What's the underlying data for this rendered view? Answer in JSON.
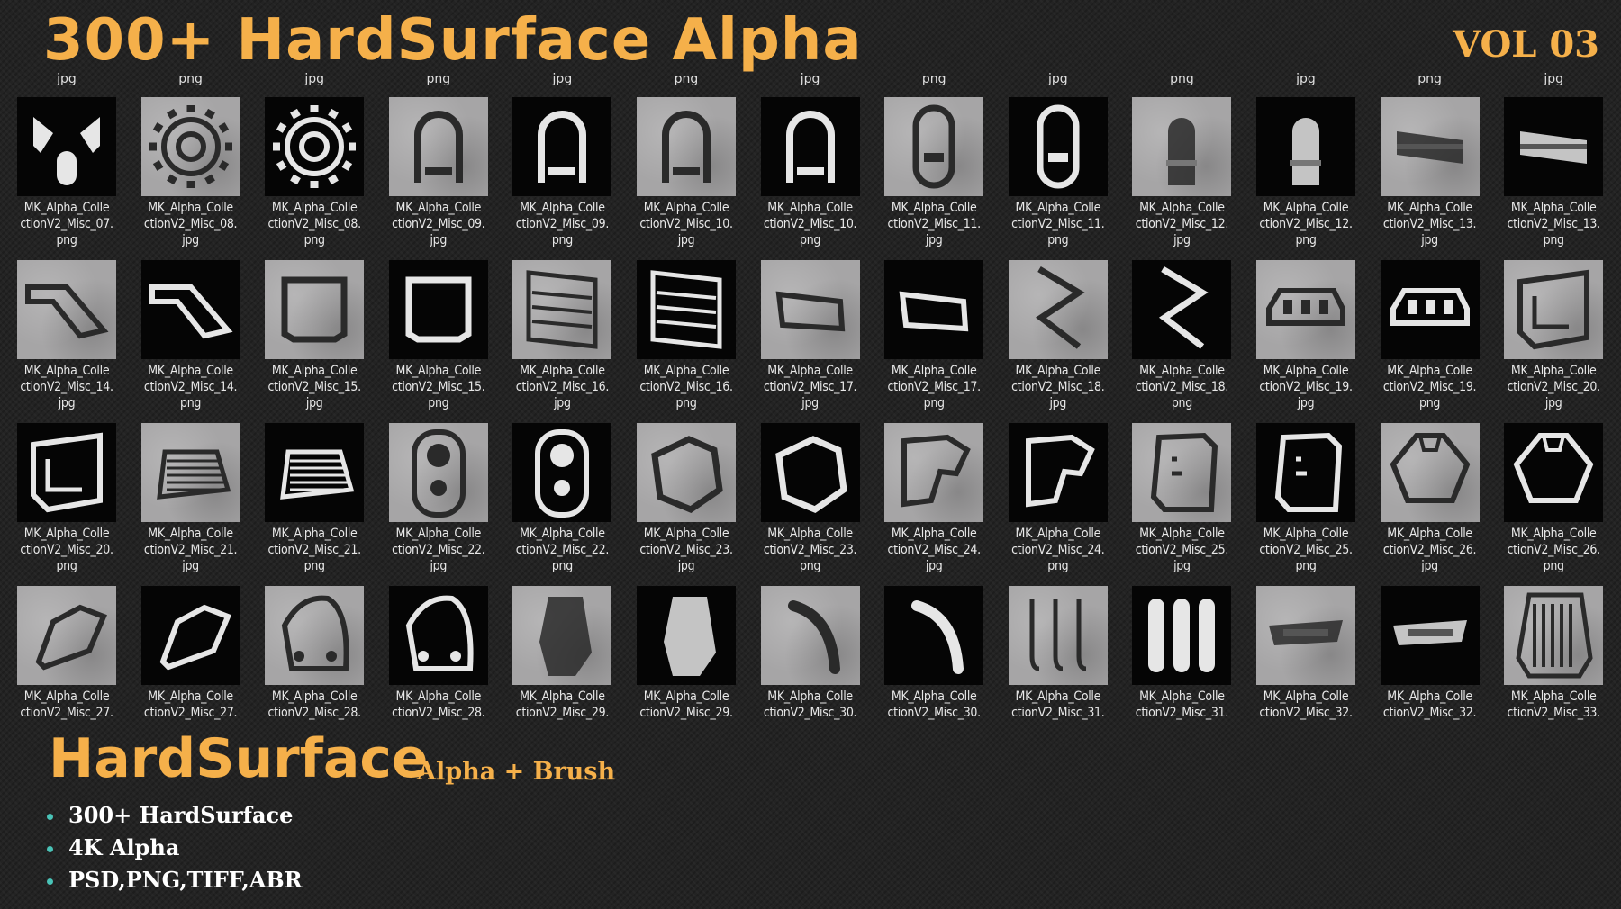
{
  "header": {
    "title": "300+ HardSurface Alpha",
    "volume": "VOL 03"
  },
  "top_exts": [
    "jpg",
    "png",
    "jpg",
    "png",
    "jpg",
    "png",
    "jpg",
    "png",
    "jpg",
    "png",
    "jpg",
    "png",
    "jpg"
  ],
  "rows": [
    [
      {
        "label": "MK_Alpha_CollectionV2_Misc_07.",
        "ext": "png",
        "bg": "black",
        "icon": "split-shape-icon"
      },
      {
        "label": "MK_Alpha_CollectionV2_Misc_08.",
        "ext": "jpg",
        "bg": "grey",
        "icon": "gear-icon"
      },
      {
        "label": "MK_Alpha_CollectionV2_Misc_08.",
        "ext": "png",
        "bg": "black",
        "icon": "gear-icon"
      },
      {
        "label": "MK_Alpha_CollectionV2_Misc_09.",
        "ext": "jpg",
        "bg": "grey",
        "icon": "arch-handle-icon"
      },
      {
        "label": "MK_Alpha_CollectionV2_Misc_09.",
        "ext": "png",
        "bg": "black",
        "icon": "arch-handle-icon"
      },
      {
        "label": "MK_Alpha_CollectionV2_Misc_10.",
        "ext": "jpg",
        "bg": "grey",
        "icon": "arch-handle-icon"
      },
      {
        "label": "MK_Alpha_CollectionV2_Misc_10.",
        "ext": "png",
        "bg": "black",
        "icon": "arch-handle-icon"
      },
      {
        "label": "MK_Alpha_CollectionV2_Misc_11.",
        "ext": "jpg",
        "bg": "grey",
        "icon": "capsule-icon"
      },
      {
        "label": "MK_Alpha_CollectionV2_Misc_11.",
        "ext": "png",
        "bg": "black",
        "icon": "capsule-icon"
      },
      {
        "label": "MK_Alpha_CollectionV2_Misc_12.",
        "ext": "jpg",
        "bg": "grey",
        "icon": "bullet-icon"
      },
      {
        "label": "MK_Alpha_CollectionV2_Misc_12.",
        "ext": "png",
        "bg": "black",
        "icon": "bullet-icon"
      },
      {
        "label": "MK_Alpha_CollectionV2_Misc_13.",
        "ext": "jpg",
        "bg": "grey",
        "icon": "bar-plate-icon"
      },
      {
        "label": "MK_Alpha_CollectionV2_Misc_13.",
        "ext": "png",
        "bg": "black",
        "icon": "bar-plate-icon"
      }
    ],
    [
      {
        "label": "MK_Alpha_CollectionV2_Misc_14.",
        "ext": "jpg",
        "bg": "grey",
        "icon": "slant-panel-icon"
      },
      {
        "label": "MK_Alpha_CollectionV2_Misc_14.",
        "ext": "png",
        "bg": "black",
        "icon": "slant-panel-icon"
      },
      {
        "label": "MK_Alpha_CollectionV2_Misc_15.",
        "ext": "jpg",
        "bg": "grey",
        "icon": "square-panel-icon"
      },
      {
        "label": "MK_Alpha_CollectionV2_Misc_15.",
        "ext": "png",
        "bg": "black",
        "icon": "square-panel-icon"
      },
      {
        "label": "MK_Alpha_CollectionV2_Misc_16.",
        "ext": "jpg",
        "bg": "grey",
        "icon": "vent-panel-icon"
      },
      {
        "label": "MK_Alpha_CollectionV2_Misc_16.",
        "ext": "png",
        "bg": "black",
        "icon": "vent-panel-icon"
      },
      {
        "label": "MK_Alpha_CollectionV2_Misc_17.",
        "ext": "jpg",
        "bg": "grey",
        "icon": "flat-panel-icon"
      },
      {
        "label": "MK_Alpha_CollectionV2_Misc_17.",
        "ext": "png",
        "bg": "black",
        "icon": "flat-panel-icon"
      },
      {
        "label": "MK_Alpha_CollectionV2_Misc_18.",
        "ext": "jpg",
        "bg": "grey",
        "icon": "zigzag-icon"
      },
      {
        "label": "MK_Alpha_CollectionV2_Misc_18.",
        "ext": "png",
        "bg": "black",
        "icon": "zigzag-icon"
      },
      {
        "label": "MK_Alpha_CollectionV2_Misc_19.",
        "ext": "jpg",
        "bg": "grey",
        "icon": "mechanical-part-icon"
      },
      {
        "label": "MK_Alpha_CollectionV2_Misc_19.",
        "ext": "png",
        "bg": "black",
        "icon": "mechanical-part-icon"
      },
      {
        "label": "MK_Alpha_CollectionV2_Misc_20.",
        "ext": "jpg",
        "bg": "grey",
        "icon": "bent-plate-icon"
      }
    ],
    [
      {
        "label": "MK_Alpha_CollectionV2_Misc_20.",
        "ext": "png",
        "bg": "black",
        "icon": "bent-plate-icon"
      },
      {
        "label": "MK_Alpha_CollectionV2_Misc_21.",
        "ext": "jpg",
        "bg": "grey",
        "icon": "grille-icon"
      },
      {
        "label": "MK_Alpha_CollectionV2_Misc_21.",
        "ext": "png",
        "bg": "black",
        "icon": "grille-icon"
      },
      {
        "label": "MK_Alpha_CollectionV2_Misc_22.",
        "ext": "jpg",
        "bg": "grey",
        "icon": "double-circle-icon"
      },
      {
        "label": "MK_Alpha_CollectionV2_Misc_22.",
        "ext": "png",
        "bg": "black",
        "icon": "double-circle-icon"
      },
      {
        "label": "MK_Alpha_CollectionV2_Misc_23.",
        "ext": "jpg",
        "bg": "grey",
        "icon": "polygon-icon"
      },
      {
        "label": "MK_Alpha_CollectionV2_Misc_23.",
        "ext": "png",
        "bg": "black",
        "icon": "polygon-icon"
      },
      {
        "label": "MK_Alpha_CollectionV2_Misc_24.",
        "ext": "jpg",
        "bg": "grey",
        "icon": "boot-shape-icon"
      },
      {
        "label": "MK_Alpha_CollectionV2_Misc_24.",
        "ext": "png",
        "bg": "black",
        "icon": "boot-shape-icon"
      },
      {
        "label": "MK_Alpha_CollectionV2_Misc_25.",
        "ext": "jpg",
        "bg": "grey",
        "icon": "notched-panel-icon"
      },
      {
        "label": "MK_Alpha_CollectionV2_Misc_25.",
        "ext": "png",
        "bg": "black",
        "icon": "notched-panel-icon"
      },
      {
        "label": "MK_Alpha_CollectionV2_Misc_26.",
        "ext": "jpg",
        "bg": "grey",
        "icon": "shield-plate-icon"
      },
      {
        "label": "MK_Alpha_CollectionV2_Misc_26.",
        "ext": "png",
        "bg": "black",
        "icon": "shield-plate-icon"
      }
    ],
    [
      {
        "label": "MK_Alpha_CollectionV2_Misc_27.",
        "ext": "",
        "bg": "grey",
        "icon": "seat-panel-icon"
      },
      {
        "label": "MK_Alpha_CollectionV2_Misc_27.",
        "ext": "",
        "bg": "black",
        "icon": "seat-panel-icon"
      },
      {
        "label": "MK_Alpha_CollectionV2_Misc_28.",
        "ext": "",
        "bg": "grey",
        "icon": "rounded-triangle-icon"
      },
      {
        "label": "MK_Alpha_CollectionV2_Misc_28.",
        "ext": "",
        "bg": "black",
        "icon": "rounded-triangle-icon"
      },
      {
        "label": "MK_Alpha_CollectionV2_Misc_29.",
        "ext": "",
        "bg": "grey",
        "icon": "hexagon-plate-icon"
      },
      {
        "label": "MK_Alpha_CollectionV2_Misc_29.",
        "ext": "",
        "bg": "black",
        "icon": "hexagon-plate-icon"
      },
      {
        "label": "MK_Alpha_CollectionV2_Misc_30.",
        "ext": "",
        "bg": "grey",
        "icon": "curved-tube-icon"
      },
      {
        "label": "MK_Alpha_CollectionV2_Misc_30.",
        "ext": "",
        "bg": "black",
        "icon": "curved-tube-icon"
      },
      {
        "label": "MK_Alpha_CollectionV2_Misc_31.",
        "ext": "",
        "bg": "grey",
        "icon": "hooks-icon"
      },
      {
        "label": "MK_Alpha_CollectionV2_Misc_31.",
        "ext": "",
        "bg": "black",
        "icon": "pills-icon"
      },
      {
        "label": "MK_Alpha_CollectionV2_Misc_32.",
        "ext": "",
        "bg": "grey",
        "icon": "handle-bar-icon"
      },
      {
        "label": "MK_Alpha_CollectionV2_Misc_32.",
        "ext": "",
        "bg": "black",
        "icon": "handle-bar-icon"
      },
      {
        "label": "MK_Alpha_CollectionV2_Misc_33.",
        "ext": "",
        "bg": "grey",
        "icon": "vent-grate-icon"
      }
    ]
  ],
  "footer": {
    "title": "HardSurface",
    "subtitle": "Alpha + Brush",
    "features": [
      "300+ HardSurface",
      "4K Alpha",
      "PSD,PNG,TIFF,ABR"
    ]
  },
  "colors": {
    "accent": "#f5b04a",
    "bullet": "#49c3b7",
    "background": "#232323"
  }
}
